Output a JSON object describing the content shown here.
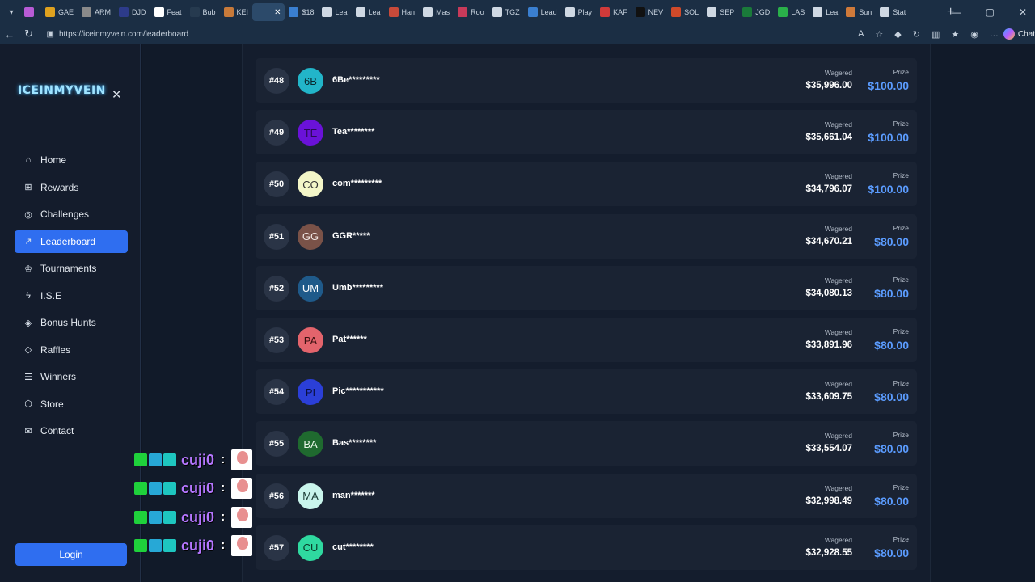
{
  "browser": {
    "tabs": [
      {
        "label": "",
        "color": "#b85bd6"
      },
      {
        "label": "GAE",
        "color": "#e0a21f"
      },
      {
        "label": "ARM",
        "color": "#8a8a8a"
      },
      {
        "label": "DJD",
        "color": "#2d3b8a"
      },
      {
        "label": "Feat",
        "color": "#ffffff"
      },
      {
        "label": "Bub",
        "color": "#263a4f"
      },
      {
        "label": "KEI",
        "color": "#c87a3a"
      },
      {
        "label": "",
        "color": "#2c4a6a",
        "active": true
      },
      {
        "label": "$18",
        "color": "#3a7fd0"
      },
      {
        "label": "Lea",
        "color": "#cfd8e3"
      },
      {
        "label": "Lea",
        "color": "#cfd8e3"
      },
      {
        "label": "Han",
        "color": "#c84a3a"
      },
      {
        "label": "Mas",
        "color": "#cfd8e3"
      },
      {
        "label": "Roo",
        "color": "#c83a5a"
      },
      {
        "label": "TGZ",
        "color": "#cfd8e3"
      },
      {
        "label": "Lead",
        "color": "#3a7fd0"
      },
      {
        "label": "Play",
        "color": "#cfd8e3"
      },
      {
        "label": "KAF",
        "color": "#d03a3a"
      },
      {
        "label": "NEV",
        "color": "#111111"
      },
      {
        "label": "SOL",
        "color": "#d04a2a"
      },
      {
        "label": "SEP",
        "color": "#cfd8e3"
      },
      {
        "label": "JGD",
        "color": "#1a7a3a"
      },
      {
        "label": "LAS",
        "color": "#2ab04a"
      },
      {
        "label": "Lea",
        "color": "#cfd8e3"
      },
      {
        "label": "Sun",
        "color": "#d07a3a"
      },
      {
        "label": "Stat",
        "color": "#cfd8e3"
      }
    ],
    "url": "https://iceinmyvein.com/leaderboard",
    "chat_label": "Chat"
  },
  "sidebar": {
    "logo": "ICEINMYVEIN",
    "items": [
      {
        "label": "Home",
        "icon": "home-icon",
        "glyph": "⌂"
      },
      {
        "label": "Rewards",
        "icon": "gift-icon",
        "glyph": "⊞"
      },
      {
        "label": "Challenges",
        "icon": "target-icon",
        "glyph": "◎"
      },
      {
        "label": "Leaderboard",
        "icon": "trend-icon",
        "glyph": "↗",
        "active": true
      },
      {
        "label": "Tournaments",
        "icon": "trophy-icon",
        "glyph": "♔"
      },
      {
        "label": "I.S.E",
        "icon": "bolt-icon",
        "glyph": "ϟ"
      },
      {
        "label": "Bonus Hunts",
        "icon": "cube-icon",
        "glyph": "◈"
      },
      {
        "label": "Raffles",
        "icon": "ticket-icon",
        "glyph": "◇"
      },
      {
        "label": "Winners",
        "icon": "list-icon",
        "glyph": "☰"
      },
      {
        "label": "Store",
        "icon": "box-icon",
        "glyph": "⬡"
      },
      {
        "label": "Contact",
        "icon": "mail-icon",
        "glyph": "✉"
      }
    ],
    "login": "Login"
  },
  "leaderboard": {
    "wagered_label": "Wagered",
    "prize_label": "Prize",
    "rows": [
      {
        "rank": "#48",
        "initials": "6B",
        "avatar_bg": "#22b5c9",
        "avatar_fg": "#0a2a30",
        "name": "6Be*********",
        "wagered": "$35,996.00",
        "prize": "$100.00"
      },
      {
        "rank": "#49",
        "initials": "TE",
        "avatar_bg": "#6a12d8",
        "avatar_fg": "#2a0a55",
        "name": "Tea********",
        "wagered": "$35,661.04",
        "prize": "$100.00"
      },
      {
        "rank": "#50",
        "initials": "CO",
        "avatar_bg": "#f3f6c8",
        "avatar_fg": "#333333",
        "name": "com*********",
        "wagered": "$34,796.07",
        "prize": "$100.00"
      },
      {
        "rank": "#51",
        "initials": "GG",
        "avatar_bg": "#7a5248",
        "avatar_fg": "#f0e6e2",
        "name": "GGR*****",
        "wagered": "$34,670.21",
        "prize": "$80.00"
      },
      {
        "rank": "#52",
        "initials": "UM",
        "avatar_bg": "#1f5a8a",
        "avatar_fg": "#ffffff",
        "name": "Umb*********",
        "wagered": "$34,080.13",
        "prize": "$80.00"
      },
      {
        "rank": "#53",
        "initials": "PA",
        "avatar_bg": "#e3646c",
        "avatar_fg": "#3a1010",
        "name": "Pat******",
        "wagered": "$33,891.96",
        "prize": "$80.00"
      },
      {
        "rank": "#54",
        "initials": "PI",
        "avatar_bg": "#2b3fd8",
        "avatar_fg": "#0a1040",
        "name": "Pic***********",
        "wagered": "$33,609.75",
        "prize": "$80.00"
      },
      {
        "rank": "#55",
        "initials": "BA",
        "avatar_bg": "#1f6a2f",
        "avatar_fg": "#e6f5e6",
        "name": "Bas********",
        "wagered": "$33,554.07",
        "prize": "$80.00"
      },
      {
        "rank": "#56",
        "initials": "MA",
        "avatar_bg": "#c9f5ec",
        "avatar_fg": "#1a3a33",
        "name": "man*******",
        "wagered": "$32,998.49",
        "prize": "$80.00"
      },
      {
        "rank": "#57",
        "initials": "CU",
        "avatar_bg": "#2fd9a0",
        "avatar_fg": "#0a3a28",
        "name": "cut********",
        "wagered": "$32,928.55",
        "prize": "$80.00"
      }
    ]
  },
  "chat_overlay": {
    "messages": [
      {
        "user": "cuji0",
        "sep": ":"
      },
      {
        "user": "cuji0",
        "sep": ":"
      },
      {
        "user": "cuji0",
        "sep": ":"
      },
      {
        "user": "cuji0",
        "sep": ":"
      }
    ]
  }
}
